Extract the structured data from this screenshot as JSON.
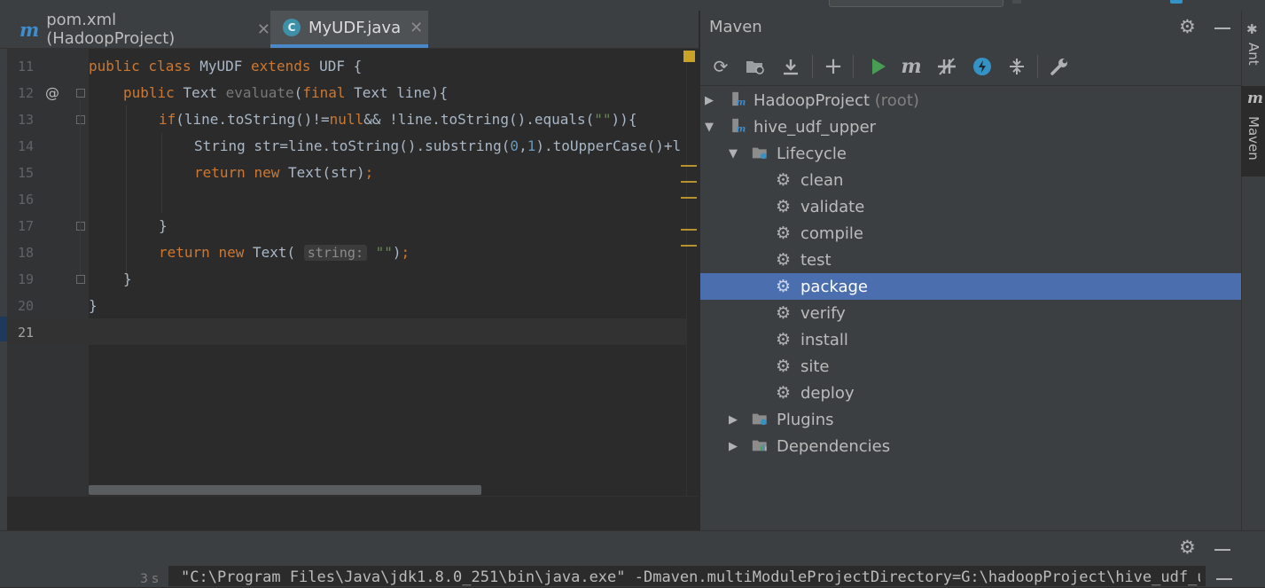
{
  "editor": {
    "tabs": [
      {
        "label": "pom.xml (HadoopProject)",
        "icon": "maven-m-icon",
        "active": false
      },
      {
        "label": "MyUDF.java",
        "icon": "java-class-icon",
        "active": true
      }
    ],
    "line_numbers": [
      "11",
      "12",
      "13",
      "14",
      "15",
      "16",
      "17",
      "18",
      "19",
      "20",
      "21"
    ],
    "current_line": "21",
    "override_marker": "@",
    "code": {
      "l11": {
        "kw1": "public class ",
        "name": "MyUDF",
        "kw2": " extends ",
        "rest": "UDF {"
      },
      "l12": {
        "kw1": "public ",
        "type": "Text ",
        "fn": "evaluate",
        "p1": "(",
        "kw2": "final ",
        "rest": "Text line){"
      },
      "l13": {
        "kw1": "if",
        "a": "(line.toString()!=",
        "kw2": "null",
        "b": "&& !line.toString().equals(",
        "str": "\"\"",
        "c": ")){"
      },
      "l14": {
        "a": "String str=line.toString().substring(",
        "n0": "0",
        "comma": ",",
        "n1": "1",
        "b": ").toUpperCase()+l"
      },
      "l15": {
        "kw1": "return ",
        "kw2": "new ",
        "a": "Text(str)",
        "semi": ";"
      },
      "l17": {
        "brace": "}"
      },
      "l18": {
        "kw1": "return ",
        "kw2": "new ",
        "a": "Text( ",
        "hint": "string:",
        "str": " \"\"",
        "b": ")",
        "semi": ";"
      },
      "l19": {
        "brace": "}"
      },
      "l20": {
        "brace": "}"
      }
    }
  },
  "maven": {
    "title": "Maven",
    "tree": {
      "root_project": "HadoopProject",
      "root_suffix": "(root)",
      "module": "hive_udf_upper",
      "lifecycle_label": "Lifecycle",
      "phases": [
        "clean",
        "validate",
        "compile",
        "test",
        "package",
        "verify",
        "install",
        "site",
        "deploy"
      ],
      "selected_phase": "package",
      "plugins_label": "Plugins",
      "dependencies_label": "Dependencies"
    }
  },
  "side_tabs": {
    "ant": "Ant",
    "maven": "Maven"
  },
  "run": {
    "time": "3 s",
    "command": "\"C:\\Program Files\\Java\\jdk1.8.0_251\\bin\\java.exe\" -Dmaven.multiModuleProjectDirectory=G:\\hadoopProject\\hive_udf_upper"
  },
  "colors": {
    "accent": "#4a88c7",
    "selection": "#4b6eaf",
    "keyword": "#cc7832",
    "string": "#6a8759",
    "number": "#6897bb",
    "run_green": "#499c54"
  }
}
